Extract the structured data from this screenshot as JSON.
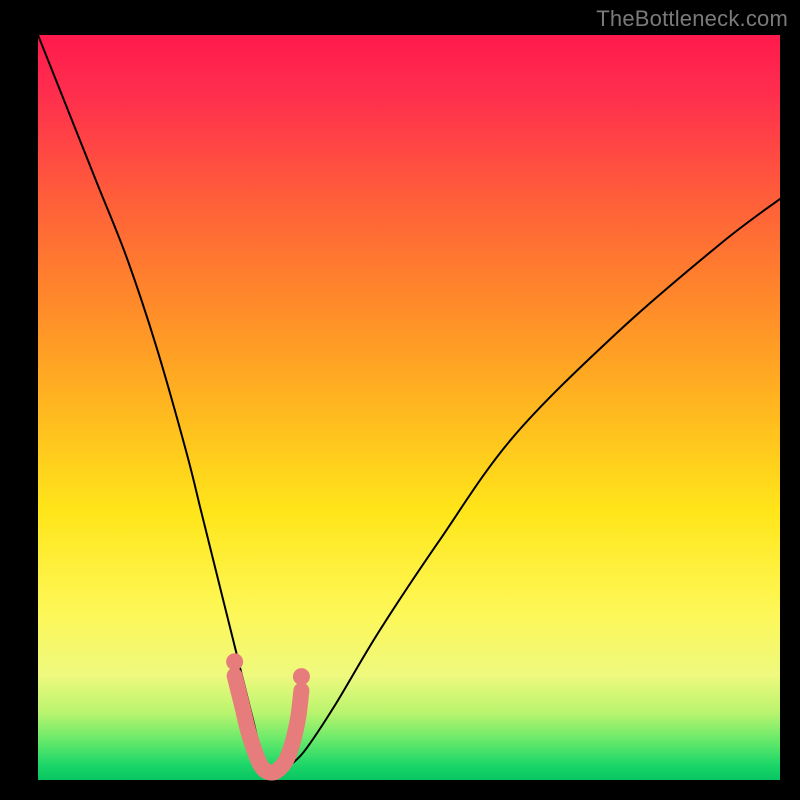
{
  "watermark": "TheBottleneck.com",
  "colors": {
    "background": "#000000",
    "gradient_top": "#ff1a4d",
    "gradient_mid": "#ffe61a",
    "gradient_bottom": "#07c561",
    "curve": "#000000",
    "marker": "#e77c7c"
  },
  "chart_data": {
    "type": "line",
    "title": "",
    "xlabel": "",
    "ylabel": "",
    "xlim": [
      0,
      100
    ],
    "ylim": [
      0,
      100
    ],
    "series": [
      {
        "name": "bottleneck-curve",
        "x": [
          0,
          4,
          8,
          12,
          16,
          20,
          22,
          24,
          26,
          28,
          29,
          30,
          31,
          32,
          33,
          34,
          36,
          40,
          46,
          54,
          64,
          78,
          92,
          100
        ],
        "values": [
          100,
          90,
          80,
          70,
          58,
          44,
          36,
          28,
          20,
          12,
          8,
          4,
          2,
          1,
          1,
          2,
          4,
          10,
          20,
          32,
          46,
          60,
          72,
          78
        ]
      }
    ],
    "markers": {
      "name": "highlighted-region",
      "x": [
        26.5,
        27.5,
        28.5,
        30.0,
        31.5,
        33.0,
        34.0,
        35.0,
        35.5
      ],
      "values": [
        14,
        10,
        6,
        2,
        1,
        2,
        4,
        8,
        12
      ]
    }
  }
}
